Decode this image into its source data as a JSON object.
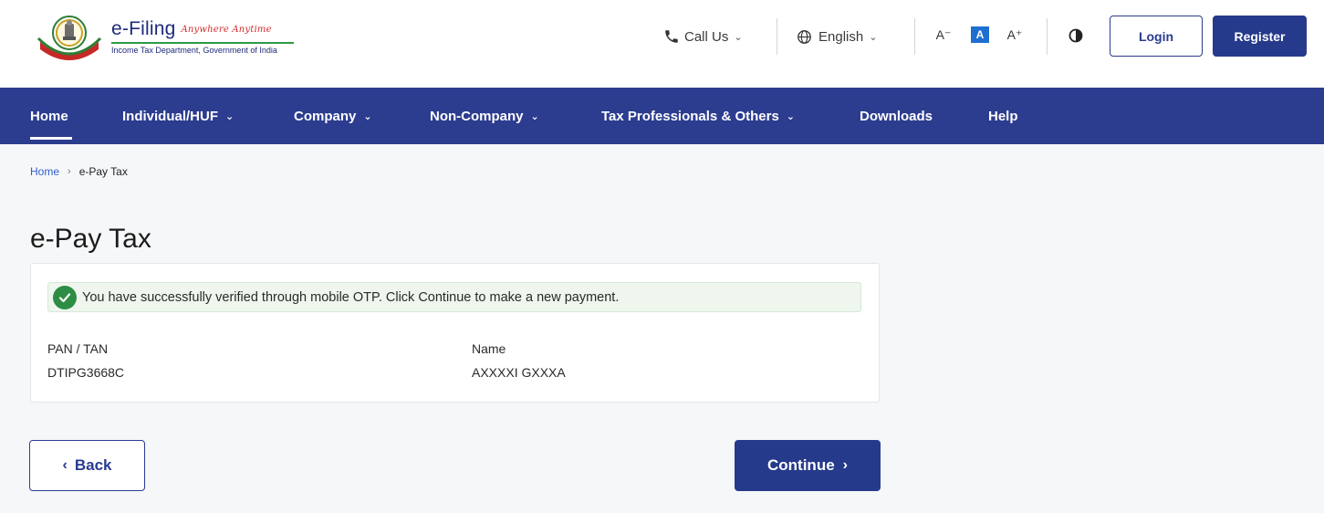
{
  "header": {
    "brand_title": "e-Filing",
    "brand_tagline": "Anywhere Anytime",
    "brand_subtitle": "Income Tax Department, Government of India",
    "call_us": "Call Us",
    "language": "English",
    "font_decrease": "A⁻",
    "font_default": "A",
    "font_increase": "A⁺",
    "login_label": "Login",
    "register_label": "Register",
    "brand_color": "#2c3c8f",
    "icons": [
      "emblem-logo-icon",
      "phone-icon",
      "globe-icon",
      "contrast-icon"
    ]
  },
  "nav": {
    "items": [
      {
        "label": "Home"
      },
      {
        "label": "Individual/HUF"
      },
      {
        "label": "Company"
      },
      {
        "label": "Non-Company"
      },
      {
        "label": "Tax Professionals & Others"
      },
      {
        "label": "Downloads"
      },
      {
        "label": "Help"
      }
    ]
  },
  "breadcrumb": {
    "home": "Home",
    "current": "e-Pay Tax"
  },
  "main": {
    "title": "e-Pay Tax",
    "alert_text": "You have successfully verified through mobile OTP. Click Continue to make a new payment.",
    "pan_label": "PAN / TAN",
    "pan_value": "DTIPG3668C",
    "name_label": "Name",
    "name_value": "AXXXXI GXXXA",
    "success_color": "#2e8d44"
  },
  "actions": {
    "back_label": "Back",
    "continue_label": "Continue"
  }
}
